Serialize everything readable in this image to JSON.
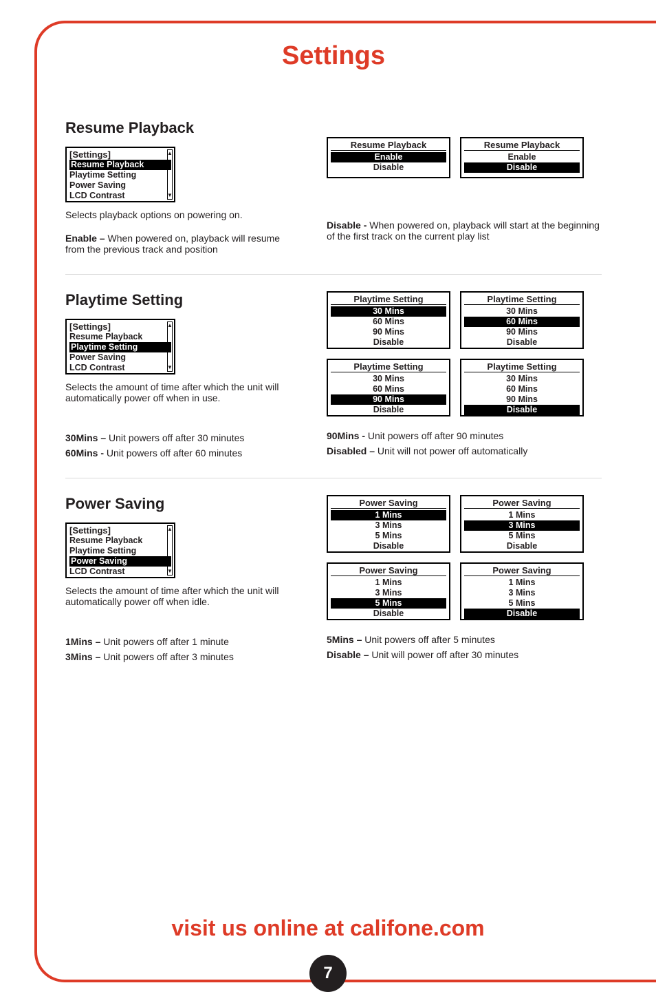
{
  "page": {
    "title": "Settings",
    "footer_text": "visit us online at califone.com",
    "page_number": "7"
  },
  "settings_menu": {
    "header": "[Settings]",
    "items": [
      "Resume Playback",
      "Playtime Setting",
      "Power Saving",
      "LCD Contrast"
    ],
    "selected": {
      "resume": 0,
      "playtime": 1,
      "power": 2
    }
  },
  "resume_playback": {
    "heading": "Resume Playback",
    "description": "Selects playback options on powering on.",
    "enable_label": "Enable –",
    "enable_text": " When powered on, playback will resume from the previous track and position",
    "disable_label": "Disable -",
    "disable_text": " When powered on, playback will start at the beginning of the first track on the current play list",
    "lcd_title": "Resume Playback",
    "options": [
      "Enable",
      "Disable"
    ]
  },
  "playtime": {
    "heading": "Playtime Setting",
    "description": "Selects the amount of time after which the unit will automatically power off when in use.",
    "lcd_title": "Playtime Setting",
    "options": [
      "30 Mins",
      "60 Mins",
      "90 Mins",
      "Disable"
    ],
    "notes": {
      "n30_label": "30Mins –",
      "n30_text": " Unit powers off after 30 minutes",
      "n60_label": "60Mins -",
      "n60_text": " Unit powers off after 60 minutes",
      "n90_label": "90Mins -",
      "n90_text": " Unit powers off after 90 minutes",
      "ndis_label": "Disabled –",
      "ndis_text": " Unit will not power off automatically"
    }
  },
  "power_saving": {
    "heading": "Power Saving",
    "description": "Selects the amount of time after which the unit will automatically power off when idle.",
    "lcd_title": "Power Saving",
    "options": [
      "1 Mins",
      "3 Mins",
      "5 Mins",
      "Disable"
    ],
    "notes": {
      "n1_label": "1Mins –",
      "n1_text": " Unit powers off after 1 minute",
      "n3_label": "3Mins –",
      "n3_text": " Unit powers off after 3 minutes",
      "n5_label": "5Mins –",
      "n5_text": " Unit powers off after 5 minutes",
      "ndis_label": "Disable –",
      "ndis_text": " Unit will power off after 30 minutes"
    }
  }
}
